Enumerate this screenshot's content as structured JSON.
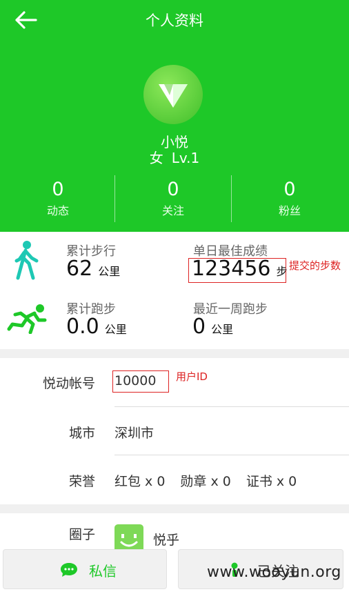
{
  "header": {
    "title": "个人资料",
    "name": "小悦",
    "gender": "女",
    "level": "Lv.1"
  },
  "stats": [
    {
      "value": "0",
      "label": "动态"
    },
    {
      "value": "0",
      "label": "关注"
    },
    {
      "value": "0",
      "label": "粉丝"
    }
  ],
  "sport": {
    "walk_label": "累计步行",
    "walk_value": "62",
    "walk_unit": "公里",
    "best_label": "单日最佳成绩",
    "best_value": "123456",
    "best_unit": "步",
    "best_note": "提交的步数",
    "run_label": "累计跑步",
    "run_value": "0.0",
    "run_unit": "公里",
    "week_label": "最近一周跑步",
    "week_value": "0",
    "week_unit": "公里"
  },
  "info": {
    "account_label": "悦动帐号",
    "account_value": "10000",
    "account_note": "用户ID",
    "city_label": "城市",
    "city_value": "深圳市",
    "honor_label": "荣誉",
    "honor_hongbao": "红包 x 0",
    "honor_medal": "勋章 x 0",
    "honor_cert": "证书 x 0"
  },
  "circle": {
    "label": "圈子",
    "name": "悦乎"
  },
  "actions": {
    "message": "私信",
    "follow": "已关注"
  },
  "watermark": "www.wooyun.org",
  "colors": {
    "brand_green": "#1ec828",
    "note_red": "#d22222"
  }
}
